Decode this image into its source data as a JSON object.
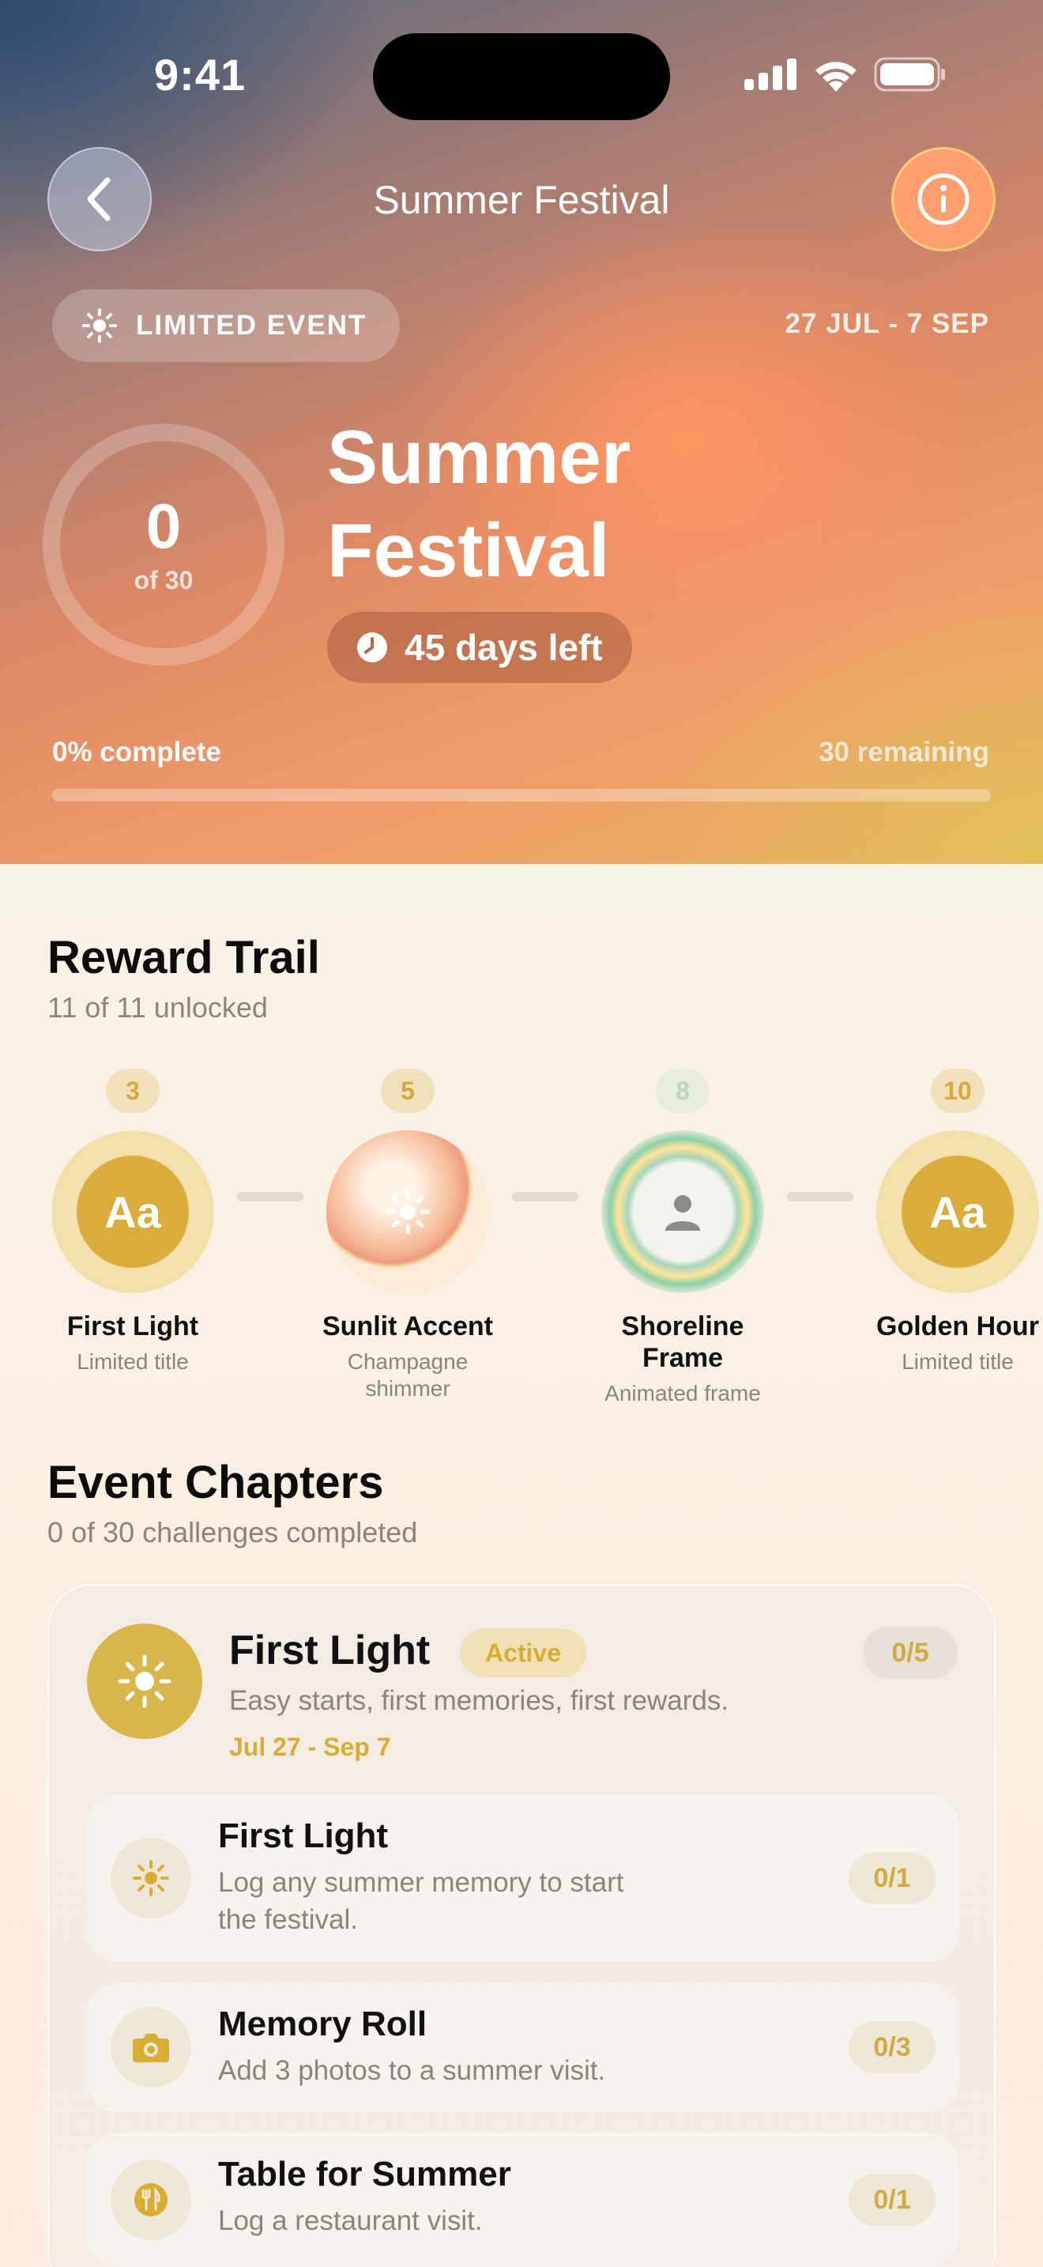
{
  "status_bar": {
    "time": "9:41"
  },
  "nav": {
    "title": "Summer Festival"
  },
  "hero": {
    "badge": "LIMITED EVENT",
    "date_range": "27 JUL - 7 SEP",
    "ring_value": "0",
    "ring_total": "of 30",
    "title_line1": "Summer",
    "title_line2": "Festival",
    "days_left": "45 days left",
    "percent_complete": "0% complete",
    "remaining": "30 remaining",
    "progress": 0
  },
  "reward_trail": {
    "title": "Reward Trail",
    "subtitle": "11 of 11 unlocked",
    "items": [
      {
        "level": "3",
        "icon": "Aa",
        "name": "First Light",
        "sub": "Limited title"
      },
      {
        "level": "5",
        "icon": "sun-icon",
        "name": "Sunlit Accent",
        "sub_line1": "Champagne",
        "sub_line2": "shimmer"
      },
      {
        "level": "8",
        "icon": "person-icon",
        "name_line1": "Shoreline",
        "name_line2": "Frame",
        "sub": "Animated frame"
      },
      {
        "level": "10",
        "icon": "Aa",
        "name": "Golden Hour",
        "sub": "Limited title"
      }
    ]
  },
  "chapters": {
    "title": "Event Chapters",
    "subtitle": "0 of 30 challenges completed",
    "chapter": {
      "title": "First Light",
      "status": "Active",
      "count": "0/5",
      "description": "Easy starts, first memories, first rewards.",
      "dates": "Jul 27 - Sep 7",
      "tasks": [
        {
          "icon": "sun-icon",
          "name": "First Light",
          "desc_line1": "Log any summer memory to start",
          "desc_line2": "the festival.",
          "count": "0/1"
        },
        {
          "icon": "camera-icon",
          "name": "Memory Roll",
          "desc": "Add 3 photos to a summer visit.",
          "count": "0/3"
        },
        {
          "icon": "utensils-icon",
          "name": "Table for Summer",
          "desc": "Log a restaurant visit.",
          "count": "0/1"
        }
      ]
    }
  },
  "colors": {
    "gold": "#d8ad33",
    "muted": "#8b8579",
    "cream": "#f8f3e7"
  }
}
